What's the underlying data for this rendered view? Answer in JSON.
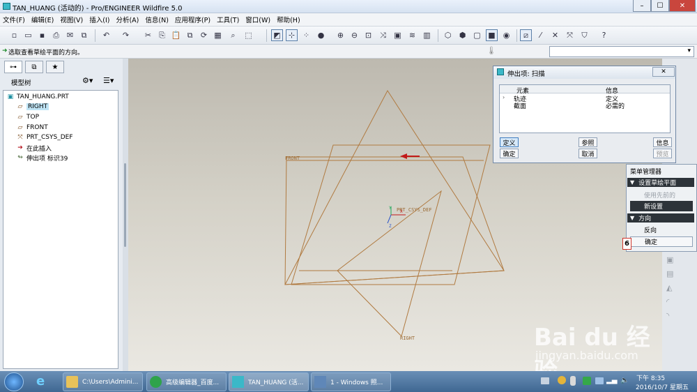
{
  "window": {
    "title": "TAN_HUANG (活动的) - Pro/ENGINEER Wildfire 5.0",
    "minimize": "–",
    "maximize": "☐",
    "close": "✕"
  },
  "menu": [
    "文件(F)",
    "编辑(E)",
    "视图(V)",
    "插入(I)",
    "分析(A)",
    "信息(N)",
    "应用程序(P)",
    "工具(T)",
    "窗口(W)",
    "帮助(H)"
  ],
  "status": {
    "message": "选取查看草绘平面的方向。"
  },
  "left_panel": {
    "tree_title": "模型树",
    "items": [
      {
        "label": "TAN_HUANG.PRT",
        "icon": "part-icon",
        "selected": false
      },
      {
        "label": "RIGHT",
        "icon": "datum-plane-icon",
        "selected": true
      },
      {
        "label": "TOP",
        "icon": "datum-plane-icon",
        "selected": false
      },
      {
        "label": "FRONT",
        "icon": "datum-plane-icon",
        "selected": false
      },
      {
        "label": "PRT_CSYS_DEF",
        "icon": "csys-icon",
        "selected": false
      },
      {
        "label": "在此插入",
        "icon": "insert-here-icon",
        "selected": false
      },
      {
        "label": "伸出项 标识39",
        "icon": "sweep-protrusion-icon",
        "selected": false
      }
    ]
  },
  "viewport": {
    "plane_labels": {
      "front": "FRONT",
      "right": "RIGHT"
    },
    "csys_label": "PRT_CSYS_DEF",
    "csys_axes": {
      "x": "X",
      "y": "Y",
      "z": "Z"
    }
  },
  "dialog": {
    "title": "伸出项: 扫描",
    "col_element": "元素",
    "col_info": "信息",
    "rows": [
      {
        "element": "轨迹",
        "info": "定义"
      },
      {
        "element": "截面",
        "info": "必需的"
      }
    ],
    "buttons": {
      "define": "定义",
      "refs": "参照",
      "info": "信息",
      "ok": "确定",
      "cancel": "取消",
      "preview": "预览"
    }
  },
  "menu_manager": {
    "title": "菜单管理器",
    "section1": "设置草绘平面",
    "use_previous": "使用先前的",
    "new_setup": "新设置",
    "section2": "方向",
    "flip": "反向",
    "okay": "确定",
    "step_marker": "6"
  },
  "taskbar": {
    "tasks": [
      {
        "label": "C:\\Users\\Admini...",
        "icon": "folder-icon"
      },
      {
        "label": "高级编辑器_百度...",
        "icon": "browser-icon"
      },
      {
        "label": "TAN_HUANG (活...",
        "icon": "proe-icon"
      },
      {
        "label": "1 - Windows 照...",
        "icon": "photo-viewer-icon"
      }
    ],
    "time": "下午 8:35",
    "date": "2016/10/7 星期五"
  },
  "watermark": {
    "brand": "Bai du 经验",
    "url": "jingyan.baidu.com"
  },
  "colors": {
    "datum": "#b07a40",
    "arrow": "#c21a1a",
    "selection": "#bfe4f5"
  }
}
